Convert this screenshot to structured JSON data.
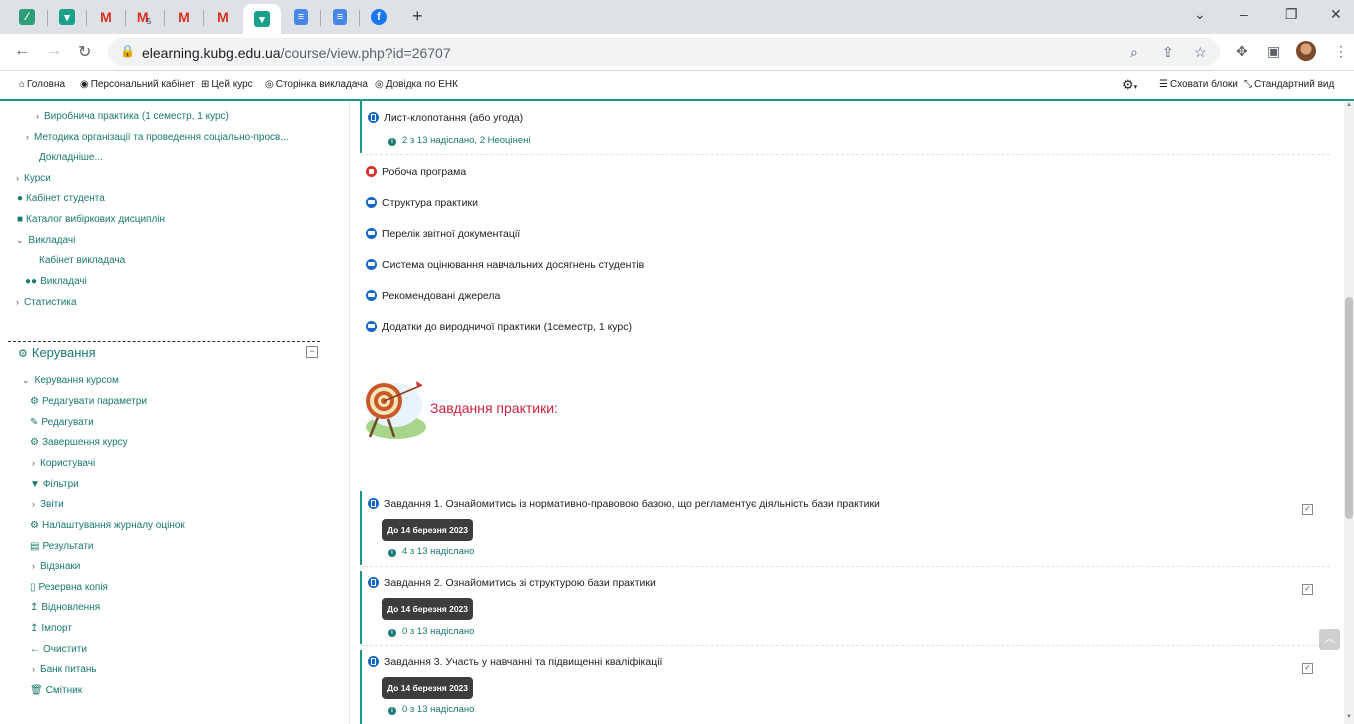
{
  "browser": {
    "url_host": "elearning.kubg.edu.ua",
    "url_path": "/course/view.php?id=26707",
    "gmail_badge": "5"
  },
  "moodlebar": {
    "home": "Головна",
    "cabinet": "Персональний кабінет",
    "this_course": "Цей курс",
    "teacher_page": "Сторінка викладача",
    "help": "Довідка по ЕНК",
    "hide_blocks": "Сховати блоки",
    "standard_view": "Стандартний вид"
  },
  "sidebar": {
    "nav": [
      {
        "label": "Виробнича практика (1 семестр, 1 курс)"
      },
      {
        "label": "Методика організації та проведення соціально-просв..."
      },
      {
        "label": "Докладніше..."
      },
      {
        "label": "Курси"
      },
      {
        "label": "Кабінет студента"
      },
      {
        "label": "Каталог вибіркових дисциплін"
      },
      {
        "label": "Викладачі"
      },
      {
        "label": "Кабінет викладача"
      },
      {
        "label": "Викладачі"
      },
      {
        "label": "Статистика"
      }
    ],
    "block_title": "Керування",
    "admin": [
      {
        "label": "Керування курсом"
      },
      {
        "label": "Редагувати параметри"
      },
      {
        "label": "Редагувати"
      },
      {
        "label": "Завершення курсу"
      },
      {
        "label": "Користувачі"
      },
      {
        "label": "Фільтри"
      },
      {
        "label": "Звіти"
      },
      {
        "label": "Налаштування журналу оцінок"
      },
      {
        "label": "Результати"
      },
      {
        "label": "Відзнаки"
      },
      {
        "label": "Резервна копія"
      },
      {
        "label": "Відновлення"
      },
      {
        "label": "Імпорт"
      },
      {
        "label": "Очистити"
      },
      {
        "label": "Банк питань"
      },
      {
        "label": "Смітник"
      }
    ]
  },
  "main": {
    "top_assignment": {
      "title": "Лист-клопотання (або угода)",
      "status": "2 з 13 надіслано, 2 Неоцінені"
    },
    "resources": [
      {
        "title": "Робоча програма"
      },
      {
        "title": "Структура практики"
      },
      {
        "title": "Перелік звітної документації"
      },
      {
        "title": "Система оцінювання навчальних досягнень студентів"
      },
      {
        "title": "Рекомендовані джерела"
      },
      {
        "title": "Додатки до виродничої практики (1семестр, 1 курс)"
      }
    ],
    "tasks_heading": "Завдання практики:",
    "tasks": [
      {
        "title": "Завдання 1. Ознайомитись із нормативно-правовою базою, що регламентує діяльність бази практики",
        "due": "До 14 березня 2023",
        "status": "4 з 13 надіслано"
      },
      {
        "title": "Завдання 2. Ознайомитись зі структурою бази практики",
        "due": "До 14 березня 2023",
        "status": "0 з 13 надіслано"
      },
      {
        "title": "Завдання 3. Участь у навчанні та підвищенні кваліфікації",
        "due": "До 14 березня 2023",
        "status": "0 з 13 надіслано"
      }
    ]
  }
}
